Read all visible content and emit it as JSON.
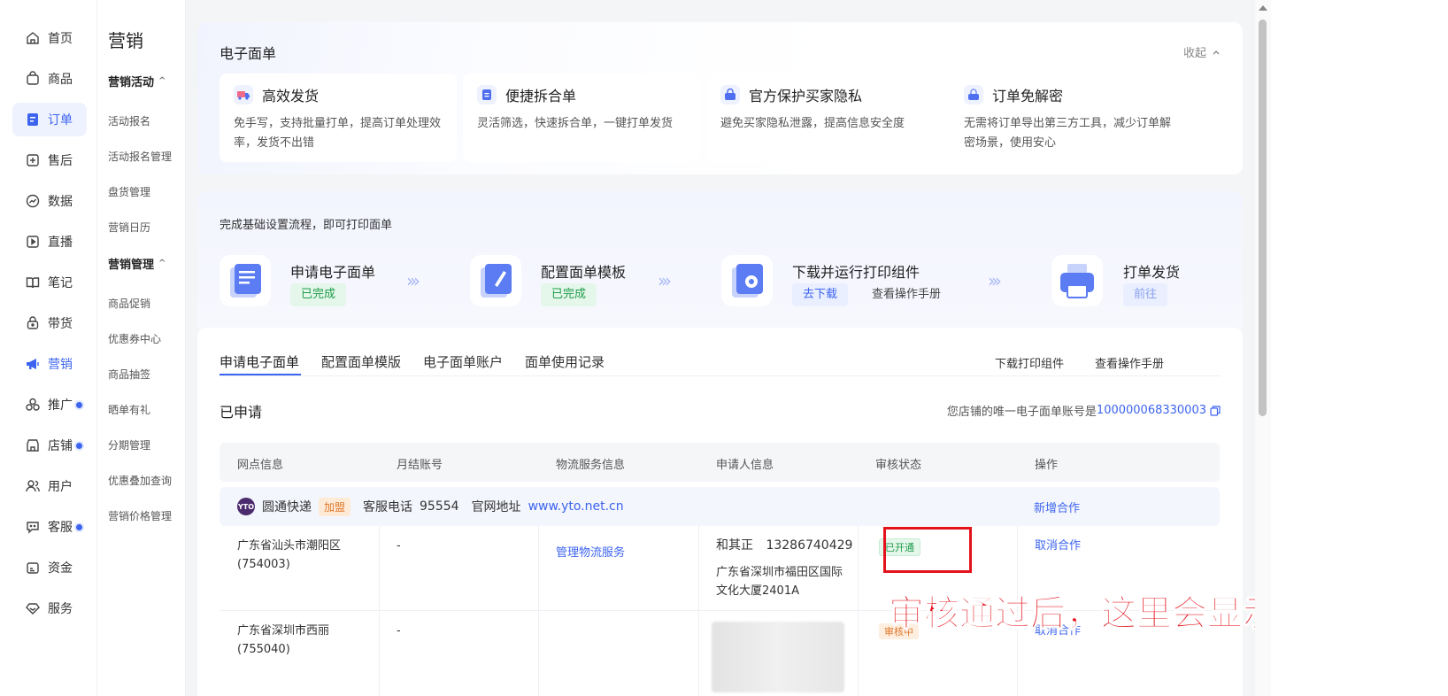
{
  "nav1": {
    "items": [
      {
        "label": "首页",
        "icon": "home-icon"
      },
      {
        "label": "商品",
        "icon": "bag-icon"
      },
      {
        "label": "订单",
        "icon": "order-icon"
      },
      {
        "label": "售后",
        "icon": "aftersale-icon"
      },
      {
        "label": "数据",
        "icon": "chart-icon"
      },
      {
        "label": "直播",
        "icon": "live-icon"
      },
      {
        "label": "笔记",
        "icon": "book-icon"
      },
      {
        "label": "带货",
        "icon": "lock-bag-icon"
      },
      {
        "label": "营销",
        "icon": "megaphone-icon"
      },
      {
        "label": "推广",
        "icon": "promote-icon"
      },
      {
        "label": "店铺",
        "icon": "store-icon"
      },
      {
        "label": "用户",
        "icon": "users-icon"
      },
      {
        "label": "客服",
        "icon": "chat-icon"
      },
      {
        "label": "资金",
        "icon": "wallet-icon"
      },
      {
        "label": "服务",
        "icon": "diamond-icon"
      }
    ],
    "active_index": 2,
    "accent_color": "#3d64ef"
  },
  "nav2": {
    "title": "营销",
    "groups": [
      {
        "label": "营销活动",
        "links": [
          "活动报名",
          "活动报名管理",
          "盘货管理",
          "营销日历"
        ]
      },
      {
        "label": "营销管理",
        "links": [
          "商品促销",
          "优惠券中心",
          "商品抽签",
          "晒单有礼",
          "分期管理",
          "优惠叠加查询",
          "营销价格管理"
        ]
      }
    ]
  },
  "features": {
    "title": "电子面单",
    "collapse_label": "收起",
    "items": [
      {
        "title": "高效发货",
        "desc": "免手写，支持批量打单，提高订单处理效率，发货不出错"
      },
      {
        "title": "便捷拆合单",
        "desc": "灵活筛选，快速拆合单，一键打单发货"
      },
      {
        "title": "官方保护买家隐私",
        "desc": "避免买家隐私泄露，提高信息安全度"
      },
      {
        "title": "订单免解密",
        "desc": "无需将订单导出第三方工具，减少订单解密场景，使用安心"
      }
    ]
  },
  "process": {
    "intro": "完成基础设置流程，即可打印面单",
    "steps": [
      {
        "name": "申请电子面单",
        "badge": "已完成"
      },
      {
        "name": "配置面单模板",
        "badge": "已完成"
      },
      {
        "name": "下载并运行打印组件",
        "badge": "去下载",
        "secondary": "查看操作手册"
      },
      {
        "name": "打单发货",
        "badge": "前往"
      }
    ],
    "arrow": "›››"
  },
  "tabs": {
    "items": [
      "申请电子面单",
      "配置面单模版",
      "电子面单账户",
      "面单使用记录"
    ],
    "active_index": 0,
    "actions": [
      "下载打印组件",
      "查看操作手册"
    ]
  },
  "applied": {
    "title": "已申请",
    "account_prefix": "您店铺的唯一电子面单账号是",
    "account_number": "100000068330003"
  },
  "table": {
    "headers": [
      "网点信息",
      "月结账号",
      "物流服务信息",
      "申请人信息",
      "审核状态",
      "操作"
    ],
    "carrier": {
      "logo_text": "YTO",
      "name": "圆通快递",
      "tag": "加盟",
      "phone_label": "客服电话",
      "phone": "95554",
      "site_label": "官网地址",
      "site": "www.yto.net.cn",
      "action": "新增合作"
    },
    "rows": [
      {
        "branch": "广东省汕头市潮阳区 (754003)",
        "monthly": "-",
        "service": "管理物流服务",
        "applicant_name": "和其正",
        "applicant_phone": "13286740429",
        "applicant_addr": "广东省深圳市福田区国际文化大厦2401A",
        "status": "已开通",
        "action": "取消合作"
      },
      {
        "branch": "广东省深圳市西丽 (755040)",
        "monthly": "-",
        "service": "",
        "status": "审核中",
        "action": "取消合作"
      }
    ]
  },
  "annotation": "审核通过后，这里会显示已开通",
  "colors": {
    "ok": "#1f9d4b",
    "pending": "#e0782a",
    "highlight": "#e4121b"
  }
}
